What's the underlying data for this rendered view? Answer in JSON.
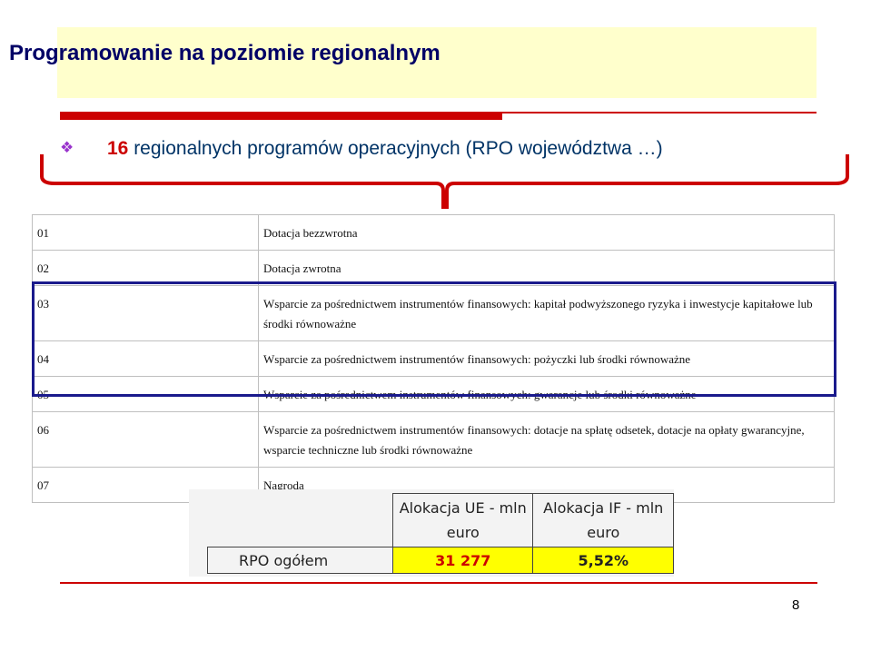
{
  "slide": {
    "title": "Programowanie na poziomie regionalnym",
    "bullet_number": "16",
    "bullet_text": " regionalnych programów operacyjnych (RPO województwa …)",
    "page_number": "8"
  },
  "codes_table": [
    {
      "code": "01",
      "description": "Dotacja bezzwrotna"
    },
    {
      "code": "02",
      "description": "Dotacja zwrotna"
    },
    {
      "code": "03",
      "description": "Wsparcie za pośrednictwem instrumentów finansowych: kapitał podwyższonego ryzyka i inwestycje kapitałowe lub środki równoważne"
    },
    {
      "code": "04",
      "description": "Wsparcie za pośrednictwem instrumentów finansowych: pożyczki lub środki równoważne"
    },
    {
      "code": "05",
      "description": "Wsparcie za pośrednictwem instrumentów finansowych: gwarancje lub środki równoważne"
    },
    {
      "code": "06",
      "description": "Wsparcie za pośrednictwem instrumentów finansowych: dotacje na spłatę odsetek, dotacje na opłaty gwarancyjne, wsparcie techniczne lub środki równoważne"
    },
    {
      "code": "07",
      "description": "Nagroda"
    }
  ],
  "allocation_table": {
    "headers": [
      "Alokacja UE - mln euro",
      "Alokacja IF - mln euro"
    ],
    "row_label": "RPO ogółem",
    "values": [
      "31 277",
      "5,52%"
    ]
  },
  "colors": {
    "title_bg": "#ffffcc",
    "title_text": "#000066",
    "accent_red": "#cc0000",
    "frame_blue": "#1a1a8c",
    "highlight_yellow": "#ffff00"
  }
}
